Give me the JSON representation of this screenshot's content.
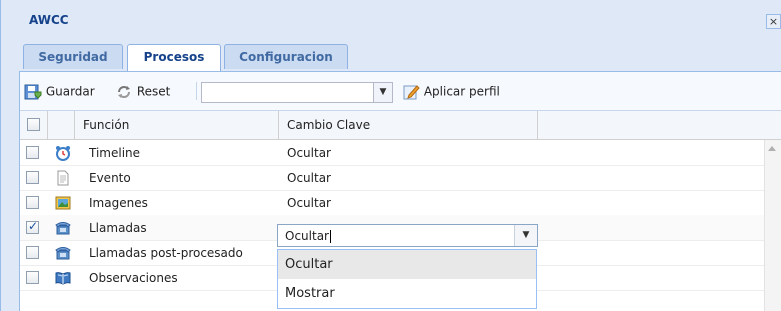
{
  "window": {
    "title": "AWCC",
    "close_glyph": "×"
  },
  "tabs": [
    {
      "label": "Seguridad",
      "active": false
    },
    {
      "label": "Procesos",
      "active": true
    },
    {
      "label": "Configuracion",
      "active": false
    }
  ],
  "toolbar": {
    "save_label": "Guardar",
    "reset_label": "Reset",
    "profile_value": "",
    "apply_label": "Aplicar perfil"
  },
  "grid": {
    "columns": {
      "funcion": "Función",
      "cambio": "Cambio Clave"
    },
    "rows": [
      {
        "funcion": "Timeline",
        "cambio": "Ocultar",
        "icon": "alarm-clock-icon",
        "checked": false
      },
      {
        "funcion": "Evento",
        "cambio": "Ocultar",
        "icon": "document-icon",
        "checked": false
      },
      {
        "funcion": "Imagenes",
        "cambio": "Ocultar",
        "icon": "image-icon",
        "checked": false
      },
      {
        "funcion": "Llamadas",
        "cambio": "Ocultar",
        "icon": "telephone-icon",
        "checked": true
      },
      {
        "funcion": "Llamadas post-procesado",
        "cambio": "",
        "icon": "telephone-icon",
        "checked": false
      },
      {
        "funcion": "Observaciones",
        "cambio": "",
        "icon": "book-icon",
        "checked": false
      }
    ]
  },
  "editor": {
    "value": "Ocultar",
    "options": [
      "Ocultar",
      "Mostrar"
    ],
    "highlighted": "Ocultar"
  },
  "colors": {
    "accent": "#15428b",
    "panel_bg": "#dfe8f6",
    "border": "#99bbe8"
  }
}
